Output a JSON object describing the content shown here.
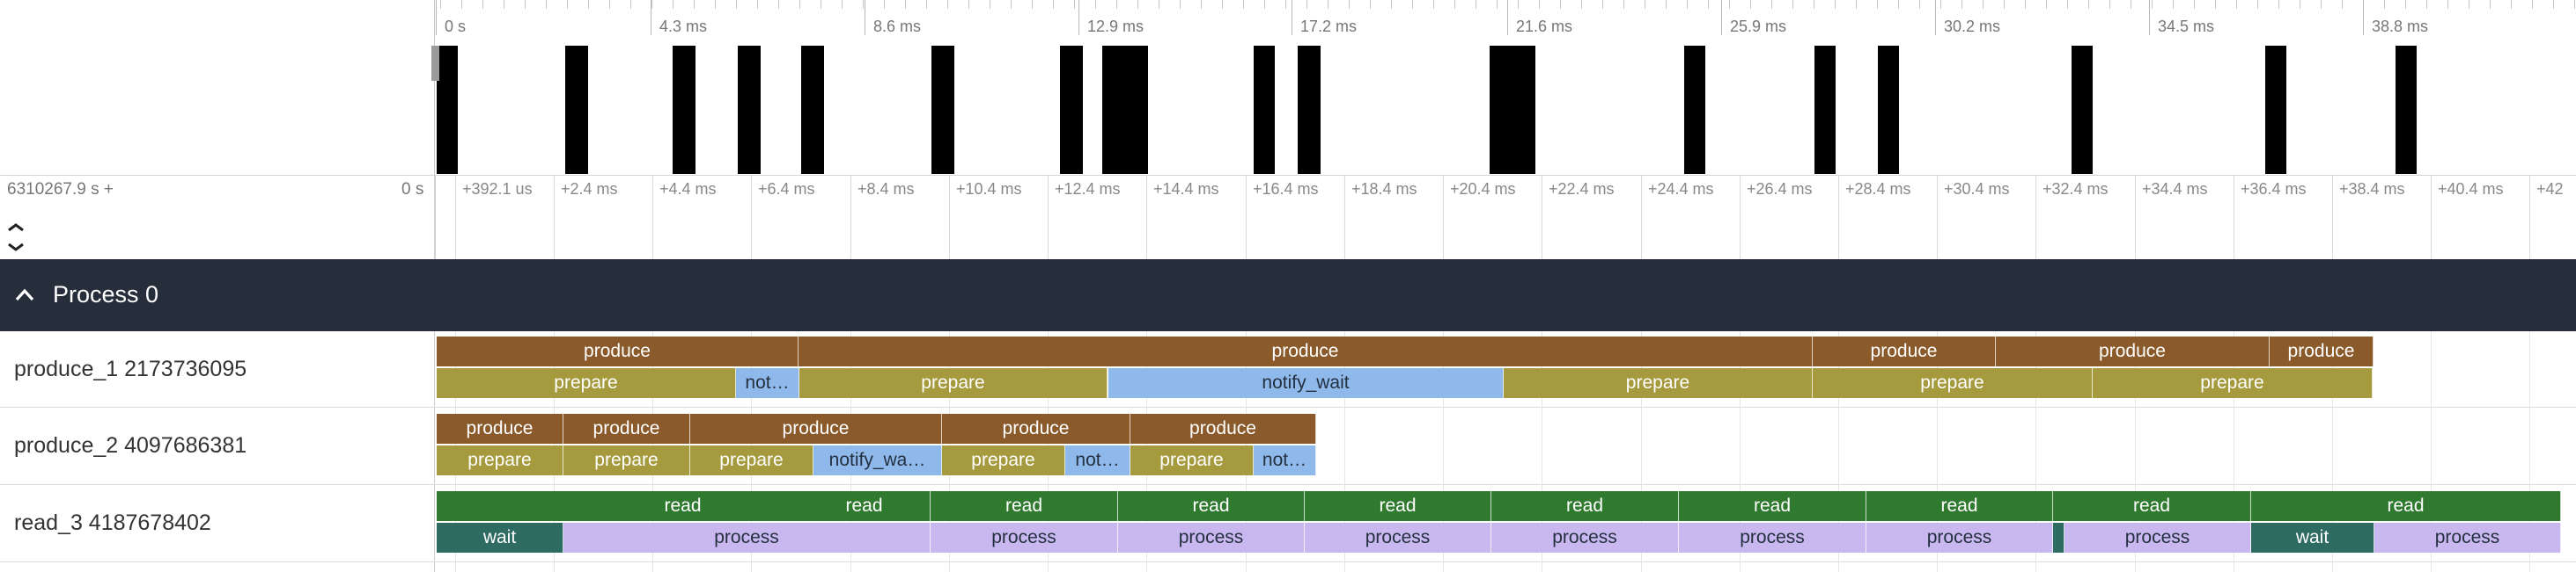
{
  "overview": {
    "time_labels": [
      "0 s",
      "4.3 ms",
      "8.6 ms",
      "12.9 ms",
      "17.2 ms",
      "21.6 ms",
      "25.9 ms",
      "30.2 ms",
      "34.5 ms",
      "38.8 ms"
    ]
  },
  "ruler": {
    "origin_label": "6310267.9 s +",
    "zero_label": "0 s",
    "tick_labels": [
      "+392.1 us",
      "+2.4 ms",
      "+4.4 ms",
      "+6.4 ms",
      "+8.4 ms",
      "+10.4 ms",
      "+12.4 ms",
      "+14.4 ms",
      "+16.4 ms",
      "+18.4 ms",
      "+20.4 ms",
      "+22.4 ms",
      "+24.4 ms",
      "+26.4 ms",
      "+28.4 ms",
      "+30.4 ms",
      "+32.4 ms",
      "+34.4 ms",
      "+36.4 ms",
      "+38.4 ms",
      "+40.4 ms",
      "+42"
    ]
  },
  "process": {
    "title": "Process 0"
  },
  "tracks": [
    {
      "label": "produce_1 2173736095"
    },
    {
      "label": "produce_2 4097686381"
    },
    {
      "label": "read_3 4187678402"
    }
  ],
  "colors": {
    "produce": "#8b5a2b",
    "prepare": "#a69a3f",
    "notify": "#8fb9ea",
    "read": "#2f7a2f",
    "wait": "#2e6b63",
    "process": "#c9b8f0",
    "header_bg": "#262e3b"
  },
  "slice_labels": {
    "produce": "produce",
    "prepare": "prepare",
    "notify_wait": "notify_wait",
    "read": "read",
    "wait": "wait",
    "process": "process"
  },
  "icons": {
    "collapse": "chevron-up-icon",
    "expand": "double-chevron-icon"
  }
}
